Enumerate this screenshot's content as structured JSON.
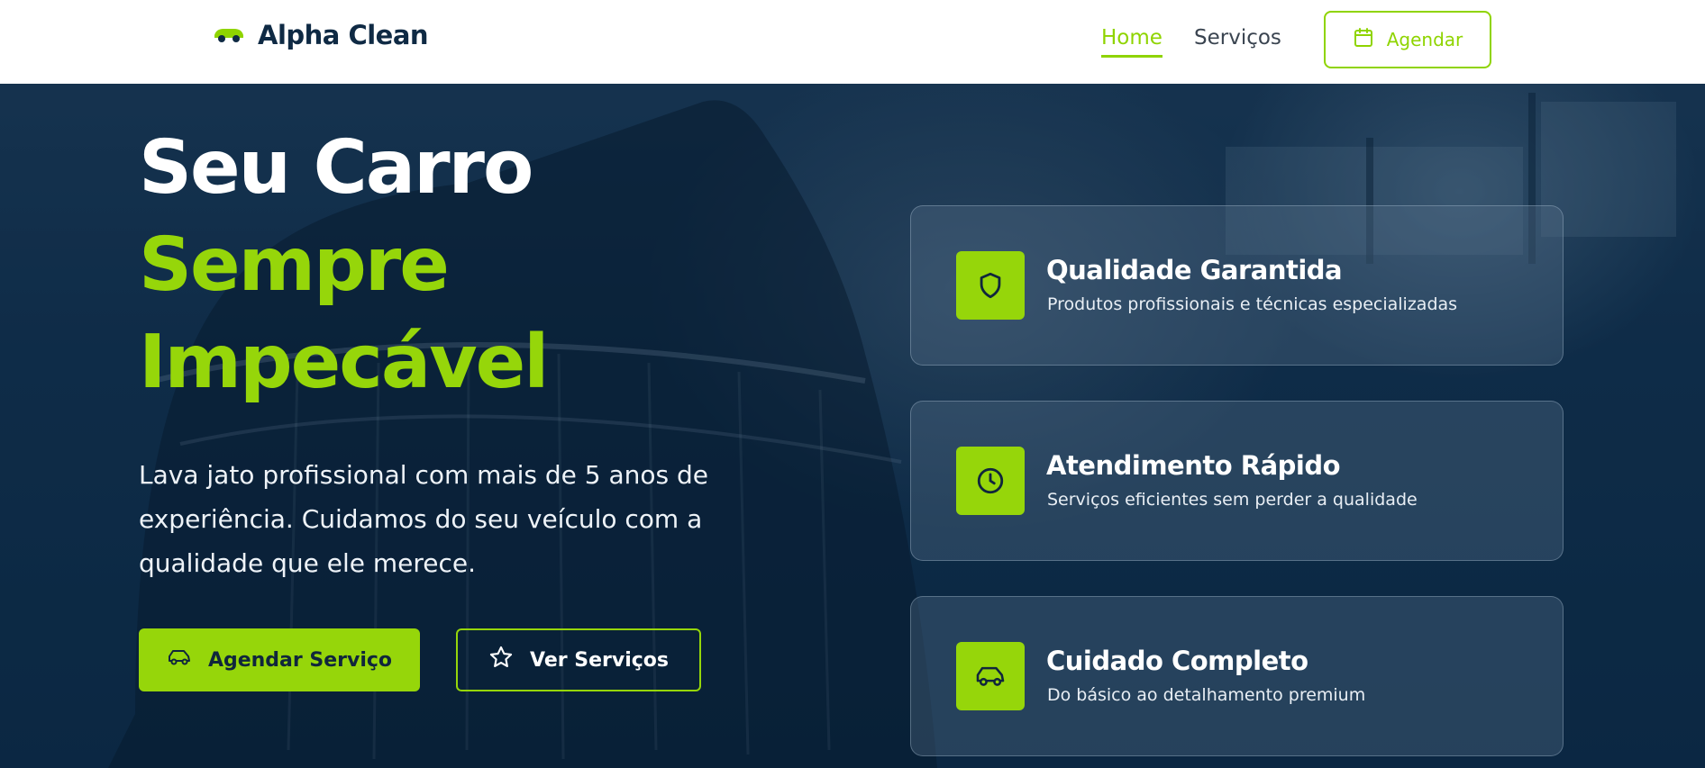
{
  "brand": {
    "name": "Alpha Clean",
    "logo_icon": "car-icon"
  },
  "nav": {
    "items": [
      {
        "label": "Home",
        "active": true
      },
      {
        "label": "Serviços",
        "active": false
      }
    ],
    "cta_label": "Agendar",
    "cta_icon": "calendar-icon"
  },
  "hero": {
    "title_line1": "Seu Carro",
    "title_line2": "Sempre",
    "title_line3": "Impecável",
    "lead": "Lava jato profissional com mais de 5 anos de experiência. Cuidamos do seu veículo com a qualidade que ele merece.",
    "primary_button": {
      "label": "Agendar Serviço",
      "icon": "car-icon"
    },
    "secondary_button": {
      "label": "Ver Serviços",
      "icon": "star-icon"
    }
  },
  "features": [
    {
      "title": "Qualidade Garantida",
      "description": "Produtos profissionais e técnicas especializadas",
      "icon": "shield-icon"
    },
    {
      "title": "Atendimento Rápido",
      "description": "Serviços eficientes sem perder a qualidade",
      "icon": "clock-icon"
    },
    {
      "title": "Cuidado Completo",
      "description": "Do básico ao detalhamento premium",
      "icon": "car-icon"
    }
  ],
  "colors": {
    "accent": "#96d60a",
    "navy": "#0f2a44",
    "white": "#ffffff"
  }
}
